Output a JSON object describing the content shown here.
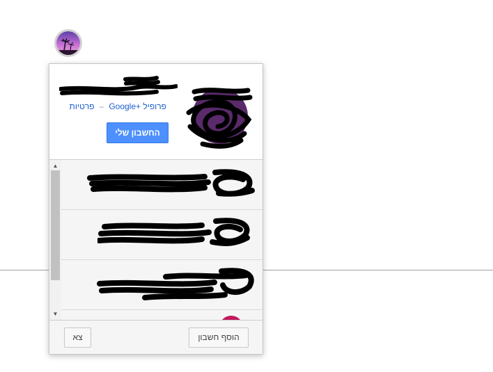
{
  "profile": {
    "privacy_link": "פרטיות",
    "separator": "–",
    "google_plus_link": "פרופיל +Google",
    "my_account_button": "החשבון שלי"
  },
  "account_list": {
    "scroll_up": "▲",
    "scroll_down": "▼"
  },
  "footer": {
    "add_account_button": "הוסף חשבון",
    "sign_out_button": "צא"
  },
  "colors": {
    "primary_button": "#4d90fe",
    "link": "#1a5fd0",
    "partial_avatar": "#c2185b"
  }
}
